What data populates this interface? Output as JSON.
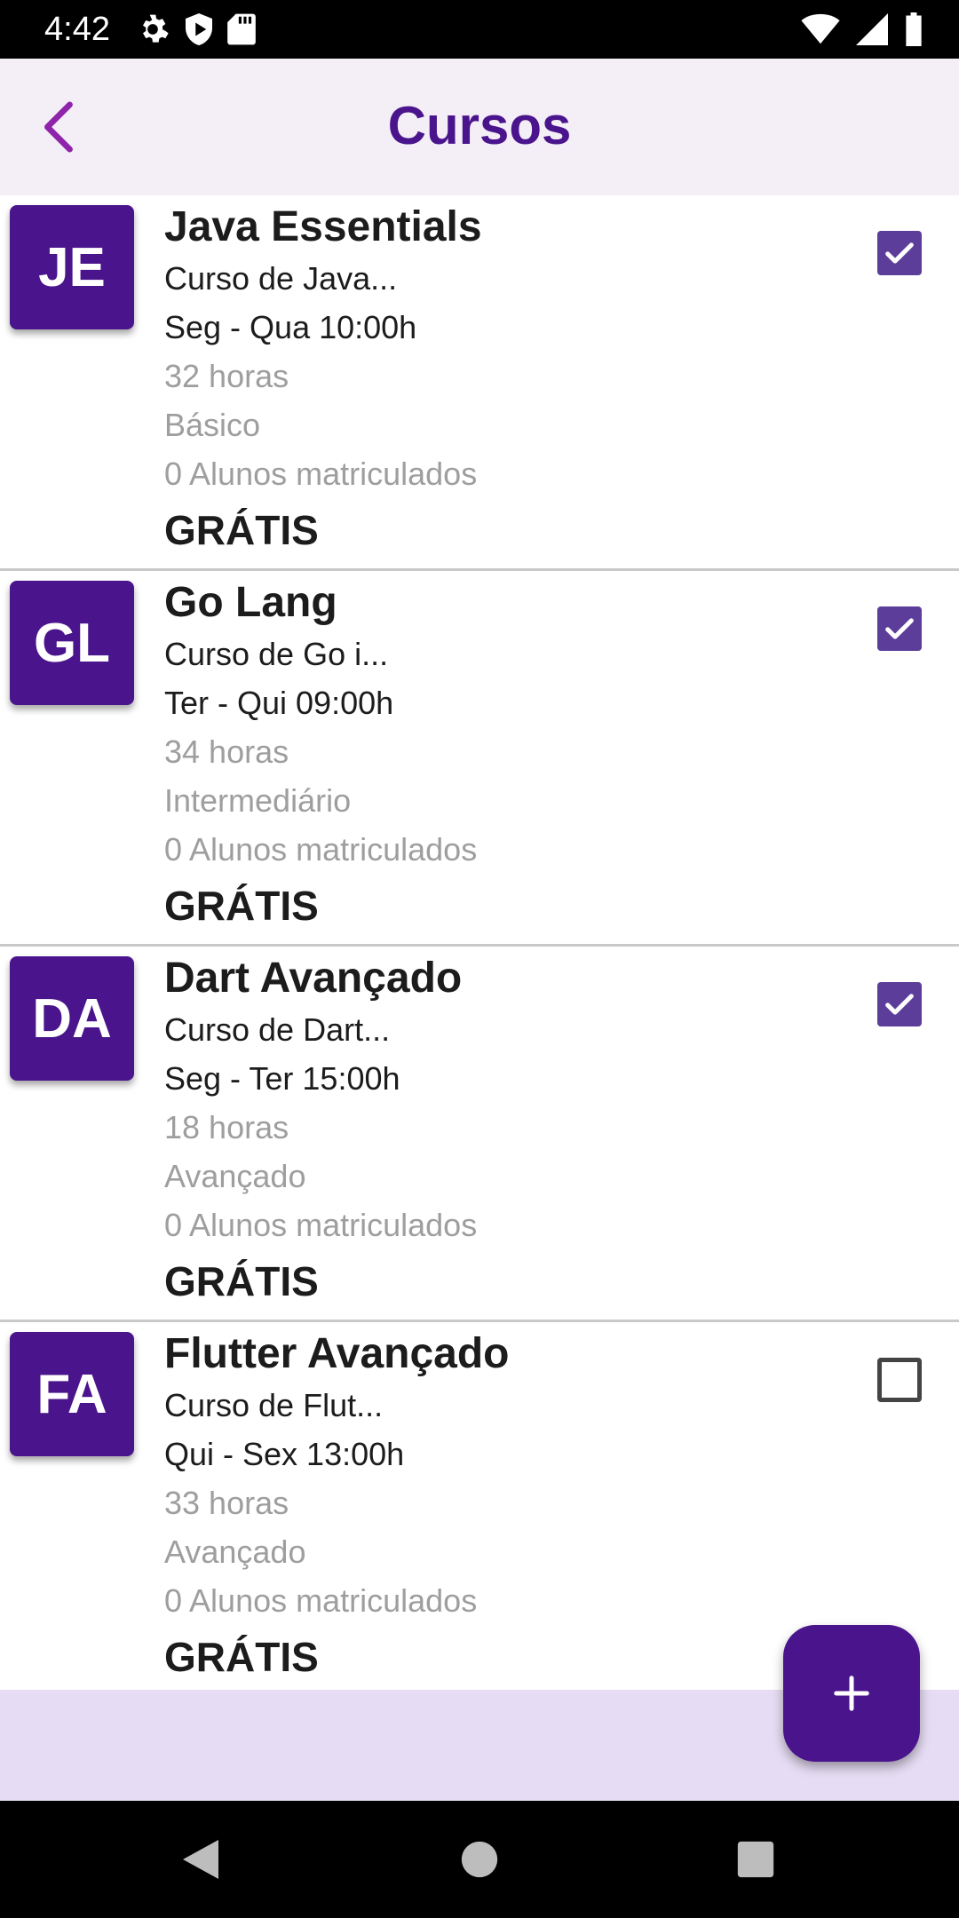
{
  "status_bar": {
    "time": "4:42",
    "icons_left": [
      "gear-icon",
      "shield-play-icon",
      "sd-card-icon"
    ],
    "icons_right": [
      "wifi-icon",
      "signal-icon",
      "battery-icon"
    ]
  },
  "appbar": {
    "title": "Cursos",
    "back_icon": "chevron-left-icon",
    "accent_color": "#4a148c"
  },
  "courses": [
    {
      "initials": "JE",
      "title": "Java Essentials",
      "description": "Curso de Java...",
      "schedule": "Seg - Qua 10:00h",
      "hours": "32 horas",
      "level": "Básico",
      "students": "0 Alunos matriculados",
      "price": "GRÁTIS",
      "checked": true
    },
    {
      "initials": "GL",
      "title": "Go Lang",
      "description": "Curso de Go i...",
      "schedule": "Ter - Qui 09:00h",
      "hours": "34 horas",
      "level": "Intermediário",
      "students": "0 Alunos matriculados",
      "price": "GRÁTIS",
      "checked": true
    },
    {
      "initials": "DA",
      "title": "Dart Avançado",
      "description": "Curso de Dart...",
      "schedule": "Seg - Ter 15:00h",
      "hours": "18 horas",
      "level": "Avançado",
      "students": "0 Alunos matriculados",
      "price": "GRÁTIS",
      "checked": true
    },
    {
      "initials": "FA",
      "title": "Flutter Avançado",
      "description": "Curso de Flut...",
      "schedule": "Qui - Sex 13:00h",
      "hours": "33 horas",
      "level": "Avançado",
      "students": "0 Alunos matriculados",
      "price": "GRÁTIS",
      "checked": false
    }
  ],
  "fab": {
    "icon": "plus-icon"
  },
  "nav_bar": {
    "icons": [
      "back-triangle-icon",
      "home-circle-icon",
      "recents-square-icon"
    ]
  },
  "colors": {
    "primary": "#4a148c",
    "checkbox": "#5c3d99",
    "appbar_bg": "#f4eff7",
    "bottom_panel_bg": "#e6dcf3"
  }
}
